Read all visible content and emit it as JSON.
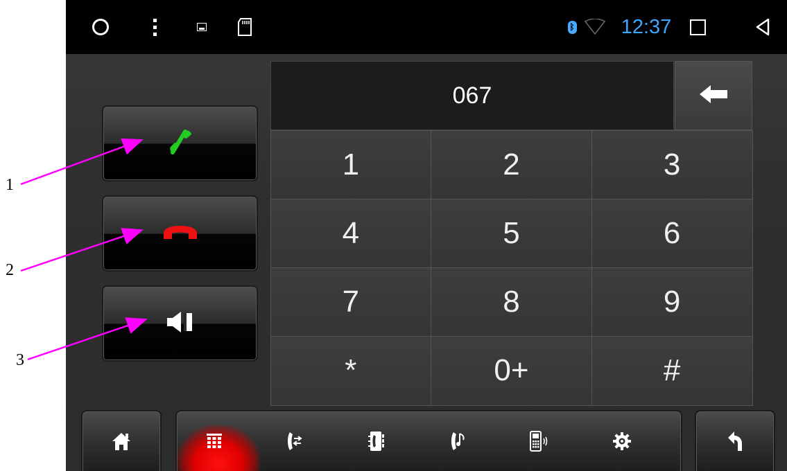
{
  "status_bar": {
    "time": "12:37",
    "icons": [
      "circle-icon",
      "overflow-menu-icon",
      "image-icon",
      "sd-card-icon",
      "bluetooth-icon",
      "wifi-icon",
      "recent-apps-icon",
      "back-icon"
    ],
    "time_color": "#3ea6ff"
  },
  "call_controls": {
    "call_icon": "phone-icon",
    "call_color": "#22cc22",
    "hangup_icon": "hang-up-icon",
    "hangup_color": "#ee1111",
    "mute_icon": "speaker-icon"
  },
  "dialer": {
    "number": "067",
    "backspace_icon": "backspace-arrow-icon",
    "keys": [
      "1",
      "2",
      "3",
      "4",
      "5",
      "6",
      "7",
      "8",
      "9",
      "*",
      "0+",
      "#"
    ]
  },
  "bottom_nav": {
    "home_icon": "home-icon",
    "items": [
      "keypad-icon",
      "call-transfer-icon",
      "contacts-icon",
      "music-icon",
      "phone-device-icon",
      "settings-icon"
    ],
    "active_item": "keypad-icon",
    "active_color": "#e00000",
    "back_icon": "return-arrow-icon"
  },
  "annotations": {
    "labels": [
      "1",
      "2",
      "3"
    ],
    "arrow_color": "#ff00ff"
  }
}
